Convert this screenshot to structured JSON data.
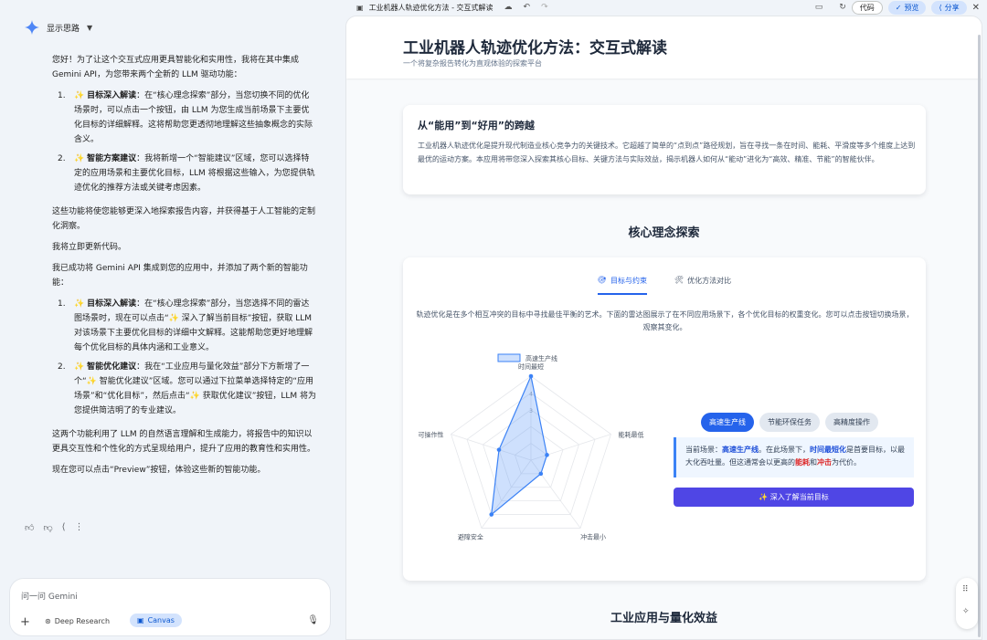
{
  "chat": {
    "header_label": "显示思路",
    "msg1_intro": "您好！为了让这个交互式应用更具智能化和实用性，我将在其中集成 Gemini API，为您带来两个全新的 LLM 驱动功能：",
    "list1": [
      {
        "num": "1.",
        "title": "目标深入解读",
        "text": "：在“核心理念探索”部分，当您切换不同的优化场景时，可以点击一个按钮，由 LLM 为您生成当前场景下主要优化目标的详细解释。这将帮助您更透彻地理解这些抽象概念的实际含义。"
      },
      {
        "num": "2.",
        "title": "智能方案建议",
        "text": "：我将新增一个“智能建议”区域，您可以选择特定的应用场景和主要优化目标，LLM 将根据这些输入，为您提供轨迹优化的推荐方法或关键考虑因素。"
      }
    ],
    "msg1_p2": "这些功能将使您能够更深入地探索报告内容，并获得基于人工智能的定制化洞察。",
    "msg1_p3": "我将立即更新代码。",
    "msg2_intro": "我已成功将 Gemini API 集成到您的应用中，并添加了两个新的智能功能：",
    "list2": [
      {
        "num": "1.",
        "title": "目标深入解读",
        "text": "：在“核心理念探索”部分，当您选择不同的雷达图场景时，现在可以点击“✨ 深入了解当前目标”按钮，获取 LLM 对该场景下主要优化目标的详细中文解释。这能帮助您更好地理解每个优化目标的具体内涵和工业意义。"
      },
      {
        "num": "2.",
        "title": "智能优化建议",
        "text": "：我在“工业应用与量化效益”部分下方新增了一个“✨ 智能优化建议”区域。您可以通过下拉菜单选择特定的“应用场景”和“优化目标”，然后点击“✨ 获取优化建议”按钮，LLM 将为您提供简洁明了的专业建议。"
      }
    ],
    "msg2_p2": "这两个功能利用了 LLM 的自然语言理解和生成能力，将报告中的知识以更具交互性和个性化的方式呈现给用户，提升了应用的教育性和实用性。",
    "msg2_p3": "现在您可以点击“Preview”按钮，体验这些新的智能功能。",
    "sparkle": "✨",
    "input_placeholder": "问一问 Gemini",
    "deep_research_label": "Deep Research",
    "canvas_label": "Canvas"
  },
  "topbar": {
    "doc_title": "工业机器人轨迹优化方法 - 交互式解读",
    "code_label": "代码",
    "preview_label": "预览",
    "share_label": "分享"
  },
  "page": {
    "title": "工业机器人轨迹优化方法：交互式解读",
    "subtitle": "一个将复杂报告转化为直观体验的探索平台",
    "intro_title": "从“能用”到“好用”的跨越",
    "intro_text": "工业机器人轨迹优化是提升现代制造业核心竞争力的关键技术。它超越了简单的“点到点”路径规划，旨在寻找一条在时间、能耗、平滑度等多个维度上达到最优的运动方案。本应用将带您深入探索其核心目标、关键方法与实际效益，揭示机器人如何从“能动”进化为“高效、精准、节能”的智能伙伴。",
    "core_title": "核心理念探索",
    "tab_goal": "目标与约束",
    "tab_compare": "优化方法对比",
    "core_desc": "轨迹优化是在多个相互冲突的目标中寻找最佳平衡的艺术。下面的雷达图展示了在不同应用场景下，各个优化目标的权重变化。您可以点击按钮切换场景，观察其变化。",
    "scenarios": [
      "高速生产线",
      "节能环保任务",
      "高精度操作"
    ],
    "note_prefix": "当前场景：",
    "note_scene": "高速生产线",
    "note_mid1": "。在此场景下，",
    "note_goal": "时间最短化",
    "note_mid2": "是首要目标，以最大化吞吐量。但这通常会以更高的",
    "note_energy": "能耗",
    "note_and": "和",
    "note_impact": "冲击",
    "note_end": "为代价。",
    "deep_btn": "✨ 深入了解当前目标",
    "section3_title": "工业应用与量化效益"
  },
  "chart_data": {
    "type": "radar",
    "legend": [
      "高速生产线"
    ],
    "axes": [
      "时间最短",
      "能耗最低",
      "冲击最小",
      "避障安全",
      "可操作性"
    ],
    "values": [
      5,
      1,
      1,
      4,
      2
    ],
    "rmax": 5,
    "tick_labels": [
      "3",
      "4"
    ],
    "color": "#3b82f6"
  }
}
